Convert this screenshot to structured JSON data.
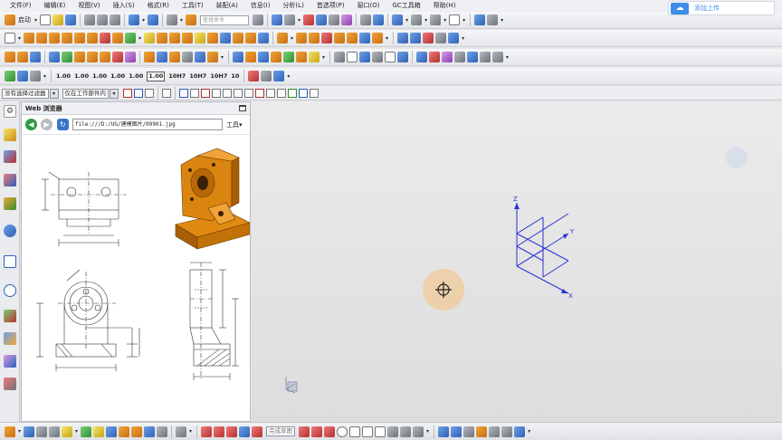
{
  "menubar": {
    "items": [
      "文件(F)",
      "编辑(E)",
      "视图(V)",
      "插入(S)",
      "格式(R)",
      "工具(T)",
      "装配(A)",
      "信息(I)",
      "分析(L)",
      "首选项(P)",
      "窗口(O)",
      "GC工具箱",
      "帮助(H)"
    ]
  },
  "toolbar1": {
    "start_label": "启动",
    "command_search_placeholder": "查找命令"
  },
  "toolbar3": {
    "dim_buttons": [
      "1.00",
      "1.00",
      "1.00",
      "1.00",
      "1.00",
      "1.00",
      "10H7",
      "10H7",
      "10H7",
      "10"
    ]
  },
  "selection_bar": {
    "filter_value": "没有选择过滤器",
    "scope_value": "仅在工作部件内"
  },
  "upload_button": {
    "label": "添加上传"
  },
  "web_panel": {
    "title": "Web 浏览器",
    "url": "file:///D:/UG/建模图片/09901.jpg",
    "tools_label": "工具"
  },
  "viewport": {
    "axes": {
      "x_label": "X",
      "y_label": "Y",
      "z_label": "Z"
    }
  },
  "statusbar": {
    "field_label": "完成草图"
  },
  "colors": {
    "accent": "#3d8ee8",
    "part_orange": "#d9860f",
    "axis_blue": "#2a34d6"
  }
}
